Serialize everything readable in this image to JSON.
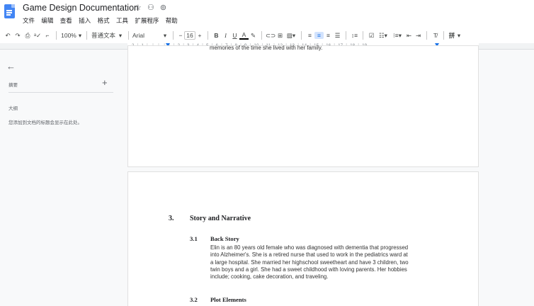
{
  "document": {
    "title": "Game Design Documentation",
    "title_icons": [
      "star-icon",
      "move-to-folder-icon",
      "cloud-status-icon"
    ]
  },
  "menu": [
    "文件",
    "编辑",
    "查看",
    "插入",
    "格式",
    "工具",
    "扩展程序",
    "帮助"
  ],
  "toolbar": {
    "zoom": "100%",
    "style": "普通文本",
    "font": "Arial",
    "font_size": "16",
    "more_label": "拼"
  },
  "ruler": {
    "ticks": [
      "2",
      "1",
      "1",
      "2",
      "3",
      "4",
      "5",
      "6",
      "7",
      "8",
      "9",
      "10",
      "11",
      "12",
      "13",
      "14",
      "15",
      "16",
      "17",
      "18",
      "19"
    ]
  },
  "sidebar": {
    "summary_label": "摘要",
    "outline_label": "大纲",
    "outline_hint": "您添加到文档的标题会显示在此处。"
  },
  "content": {
    "page1_last_line": "memories of the time she lived with her family.",
    "section_number": "3.",
    "section_title": "Story and Narrative",
    "sub1_number": "3.1",
    "sub1_title": "Back Story",
    "sub1_paragraph_lines": [
      "Elin is an 80 years old female who was diagnosed with dementia that progressed",
      "into Alzheimer's. She is a retired nurse that used to work in the pediatrics ward at",
      "a large hospital. She married her highschool sweetheart and have 3 children, two",
      "twin boys and a girl. She had a sweet childhood with loving parents. Her hobbies",
      "include; cooking, cake decoration, and traveling."
    ],
    "sub2_number": "3.2",
    "sub2_title": "Plot Elements"
  },
  "colors": {
    "accent": "#1a73e8",
    "doc_icon": "#4285f4",
    "canvas": "#f8f9fa"
  }
}
